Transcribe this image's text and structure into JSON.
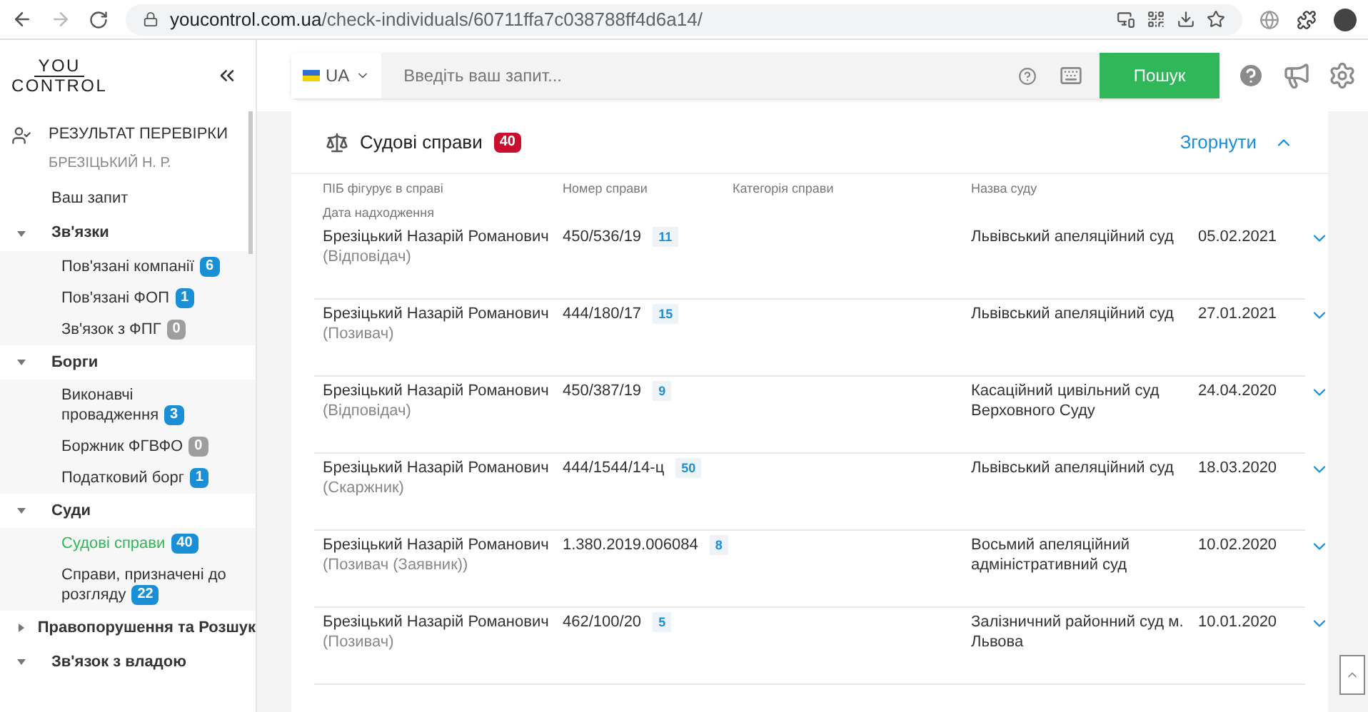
{
  "browser": {
    "url_host": "youcontrol.com.ua",
    "url_path": "/check-individuals/60711ffa7c038788ff4d6a14/"
  },
  "logo": {
    "top": "YOU",
    "bottom": "CONTROL"
  },
  "search": {
    "language": "UA",
    "placeholder": "Введіть ваш запит...",
    "button": "Пошук"
  },
  "sidebar": {
    "title": "РЕЗУЛЬТАТ ПЕРЕВІРКИ",
    "subtitle": "БРЕЗІЦЬКИЙ Н. Р.",
    "items": [
      {
        "label": "Ваш запит",
        "selected": false
      },
      {
        "label": "Зв'язки",
        "expanded": true,
        "children": [
          {
            "label": "Пов'язані компанії",
            "badge": "6",
            "color": "#1a8fd6",
            "selected": false
          },
          {
            "label": "Пов'язані ФОП",
            "badge": "1",
            "color": "#1a8fd6",
            "selected": false
          },
          {
            "label": "Зв'язок з ФПГ",
            "badge": "0",
            "color": "#9e9e9e",
            "selected": false
          }
        ]
      },
      {
        "label": "Борги",
        "expanded": true,
        "children": [
          {
            "label": "Виконавчі провадження",
            "badge": "3",
            "color": "#1a8fd6",
            "selected": false
          },
          {
            "label": "Боржник ФГВФО",
            "badge": "0",
            "color": "#9e9e9e",
            "selected": false
          },
          {
            "label": "Податковий борг",
            "badge": "1",
            "color": "#1a8fd6",
            "selected": false
          }
        ]
      },
      {
        "label": "Суди",
        "expanded": true,
        "children": [
          {
            "label": "Судові справи",
            "badge": "40",
            "color": "#1a8fd6",
            "selected": true
          },
          {
            "label": "Справи, призначені до розгляду",
            "badge": "22",
            "color": "#1a8fd6",
            "selected": false
          }
        ]
      },
      {
        "label": "Правопорушення та Розшук",
        "expanded": false
      },
      {
        "label": "Зв'язок з владою",
        "expanded": true
      }
    ]
  },
  "section": {
    "title": "Судові справи",
    "count": "40",
    "collapse": "Згорнути"
  },
  "table": {
    "columns": [
      "ПІБ фігурує в справі",
      "Номер справи",
      "Категорія справи",
      "Назва суду"
    ],
    "subheader": "Дата надходження",
    "rows": [
      {
        "name": "Брезіцький Назарій Романович",
        "role": "(Відповідач)",
        "case_number": "450/536/19",
        "count": "11",
        "court": "Львівський апеляційний суд",
        "date": "05.02.2021"
      },
      {
        "name": "Брезіцький Назарій Романович",
        "role": "(Позивач)",
        "case_number": "444/180/17",
        "count": "15",
        "court": "Львівський апеляційний суд",
        "date": "27.01.2021"
      },
      {
        "name": "Брезіцький Назарій Романович",
        "role": "(Відповідач)",
        "case_number": "450/387/19",
        "count": "9",
        "court": "Касаційний цивільний суд Верховного Суду",
        "date": "24.04.2020"
      },
      {
        "name": "Брезіцький Назарій Романович",
        "role": "(Скаржник)",
        "case_number": "444/1544/14-ц",
        "count": "50",
        "court": "Львівський апеляційний суд",
        "date": "18.03.2020"
      },
      {
        "name": "Брезіцький Назарій Романович",
        "role": "(Позивач (Заявник))",
        "case_number": "1.380.2019.006084",
        "count": "8",
        "court": "Восьмий апеляційний адміністративний суд",
        "date": "10.02.2020"
      },
      {
        "name": "Брезіцький Назарій Романович",
        "role": "(Позивач)",
        "case_number": "462/100/20",
        "count": "5",
        "court": "Залізничний районний суд м. Львова",
        "date": "10.01.2020"
      }
    ]
  }
}
